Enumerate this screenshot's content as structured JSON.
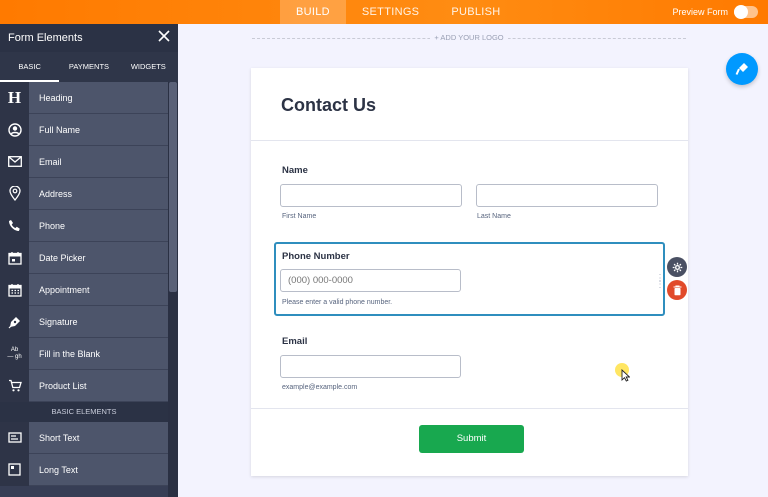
{
  "topbar": {
    "tabs": [
      {
        "label": "BUILD",
        "active": true
      },
      {
        "label": "SETTINGS",
        "active": false
      },
      {
        "label": "PUBLISH",
        "active": false
      }
    ],
    "preview_label": "Preview Form",
    "preview_on": false
  },
  "sidebar": {
    "title": "Form Elements",
    "tabs": [
      {
        "label": "BASIC",
        "active": true
      },
      {
        "label": "PAYMENTS",
        "active": false
      },
      {
        "label": "WIDGETS",
        "active": false
      }
    ],
    "items": [
      {
        "label": "Heading",
        "icon": "heading-icon"
      },
      {
        "label": "Full Name",
        "icon": "user-icon"
      },
      {
        "label": "Email",
        "icon": "envelope-icon"
      },
      {
        "label": "Address",
        "icon": "map-pin-icon"
      },
      {
        "label": "Phone",
        "icon": "phone-icon"
      },
      {
        "label": "Date Picker",
        "icon": "calendar-icon"
      },
      {
        "label": "Appointment",
        "icon": "appointment-icon"
      },
      {
        "label": "Signature",
        "icon": "signature-icon"
      },
      {
        "label": "Fill in the Blank",
        "icon": "fill-blank-icon"
      },
      {
        "label": "Product List",
        "icon": "cart-icon"
      }
    ],
    "section_label": "BASIC ELEMENTS",
    "items2": [
      {
        "label": "Short Text",
        "icon": "short-text-icon"
      },
      {
        "label": "Long Text",
        "icon": "long-text-icon"
      }
    ],
    "fill_blank_icon_text": "Ab\n— gh"
  },
  "canvas": {
    "logo_placeholder": "+ ADD YOUR LOGO"
  },
  "form": {
    "title": "Contact Us",
    "name": {
      "label": "Name",
      "first_sublabel": "First Name",
      "last_sublabel": "Last Name",
      "first_value": "",
      "last_value": ""
    },
    "phone": {
      "label": "Phone Number",
      "placeholder": "(000) 000-0000",
      "sublabel": "Please enter a valid phone number."
    },
    "email": {
      "label": "Email",
      "value": "",
      "sublabel": "example@example.com"
    },
    "submit_label": "Submit"
  },
  "colors": {
    "topbar": "#ff7a00",
    "sidebar": "#373e55",
    "accent": "#2f8ebe",
    "submit": "#18a84f",
    "delete": "#e14a2a",
    "fab": "#0099ff"
  }
}
